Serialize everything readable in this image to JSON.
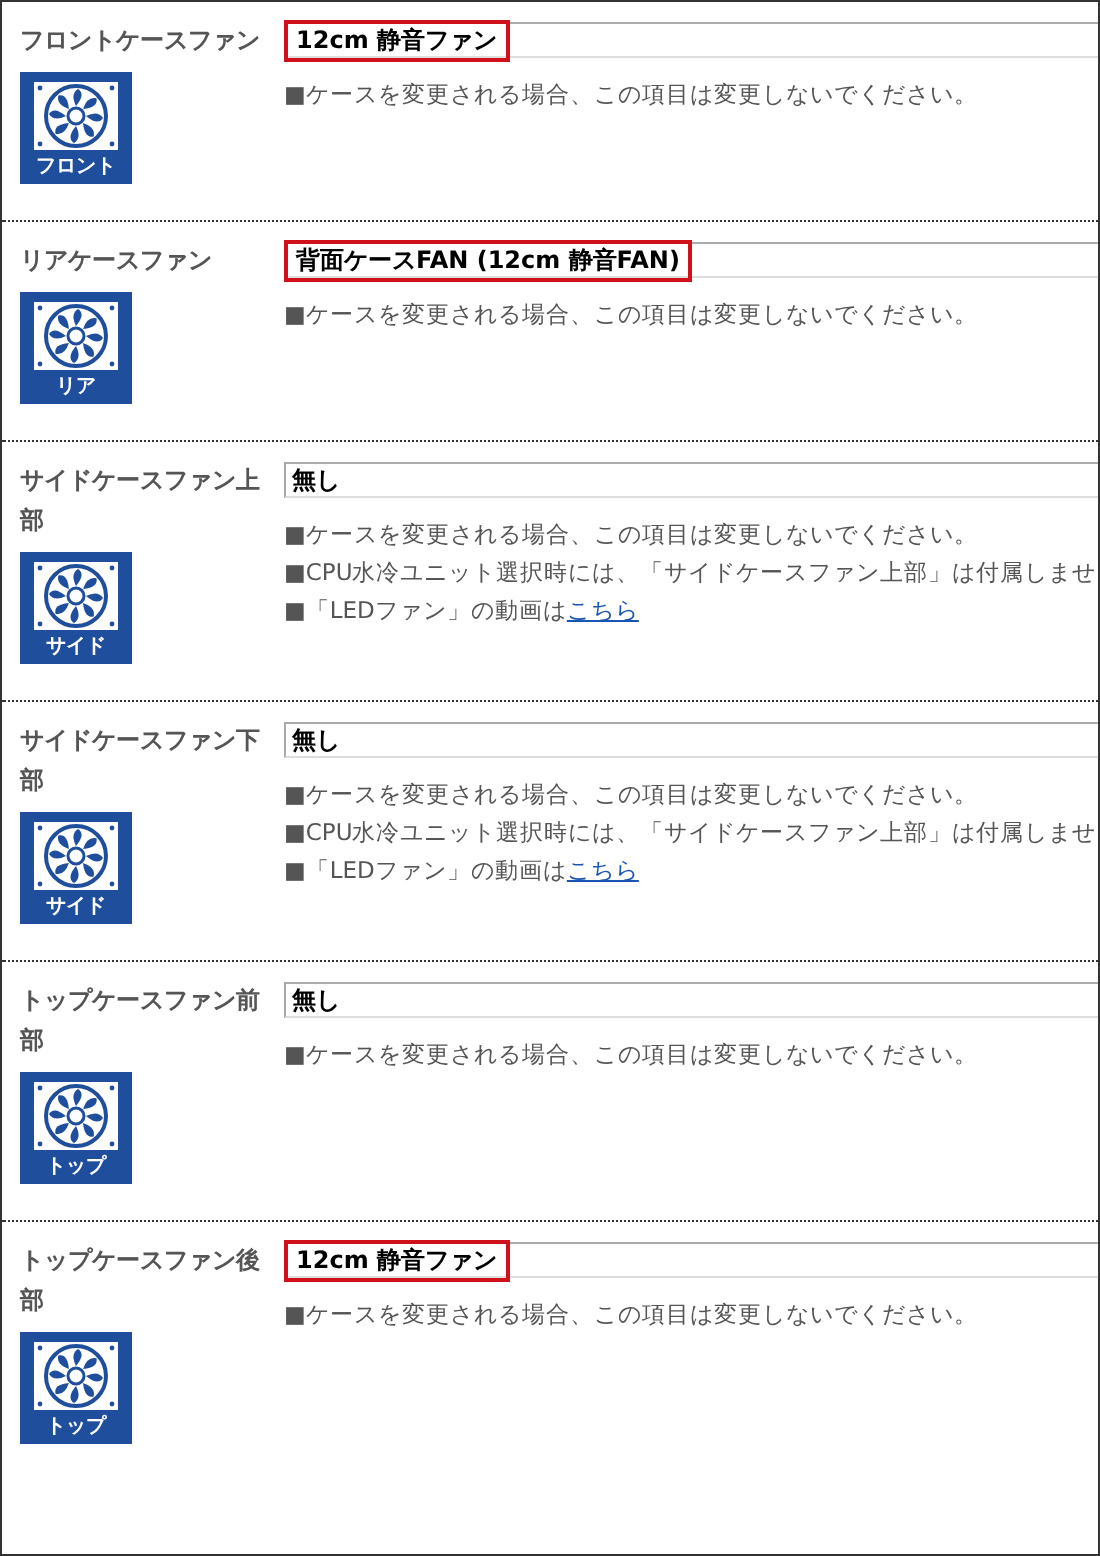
{
  "sections": [
    {
      "label": "フロントケースファン",
      "value": "12cm 静音ファン",
      "highlighted": true,
      "badge": "フロント",
      "notes": [
        {
          "text": "■ケースを変更される場合、この項目は変更しないでください。"
        }
      ]
    },
    {
      "label": "リアケースファン",
      "value": "背面ケースFAN (12cm 静音FAN)",
      "highlighted": true,
      "badge": "リア",
      "notes": [
        {
          "text": "■ケースを変更される場合、この項目は変更しないでください。"
        }
      ]
    },
    {
      "label": "サイドケースファン上部",
      "value": "無し",
      "highlighted": false,
      "badge": "サイド",
      "notes": [
        {
          "text": "■ケースを変更される場合、この項目は変更しないでください。"
        },
        {
          "text": "■CPU水冷ユニット選択時には、「サイドケースファン上部」は付属しませ"
        },
        {
          "text": "■「LEDファン」の動画は",
          "link": "こちら"
        }
      ]
    },
    {
      "label": "サイドケースファン下部",
      "value": "無し",
      "highlighted": false,
      "badge": "サイド",
      "notes": [
        {
          "text": "■ケースを変更される場合、この項目は変更しないでください。"
        },
        {
          "text": "■CPU水冷ユニット選択時には、「サイドケースファン上部」は付属しませ"
        },
        {
          "text": "■「LEDファン」の動画は",
          "link": "こちら"
        }
      ]
    },
    {
      "label": "トップケースファン前部",
      "value": "無し",
      "highlighted": false,
      "badge": "トップ",
      "notes": [
        {
          "text": "■ケースを変更される場合、この項目は変更しないでください。"
        }
      ]
    },
    {
      "label": "トップケースファン後部",
      "value": "12cm 静音ファン",
      "highlighted": true,
      "badge": "トップ",
      "notes": [
        {
          "text": "■ケースを変更される場合、この項目は変更しないでください。"
        }
      ]
    }
  ]
}
